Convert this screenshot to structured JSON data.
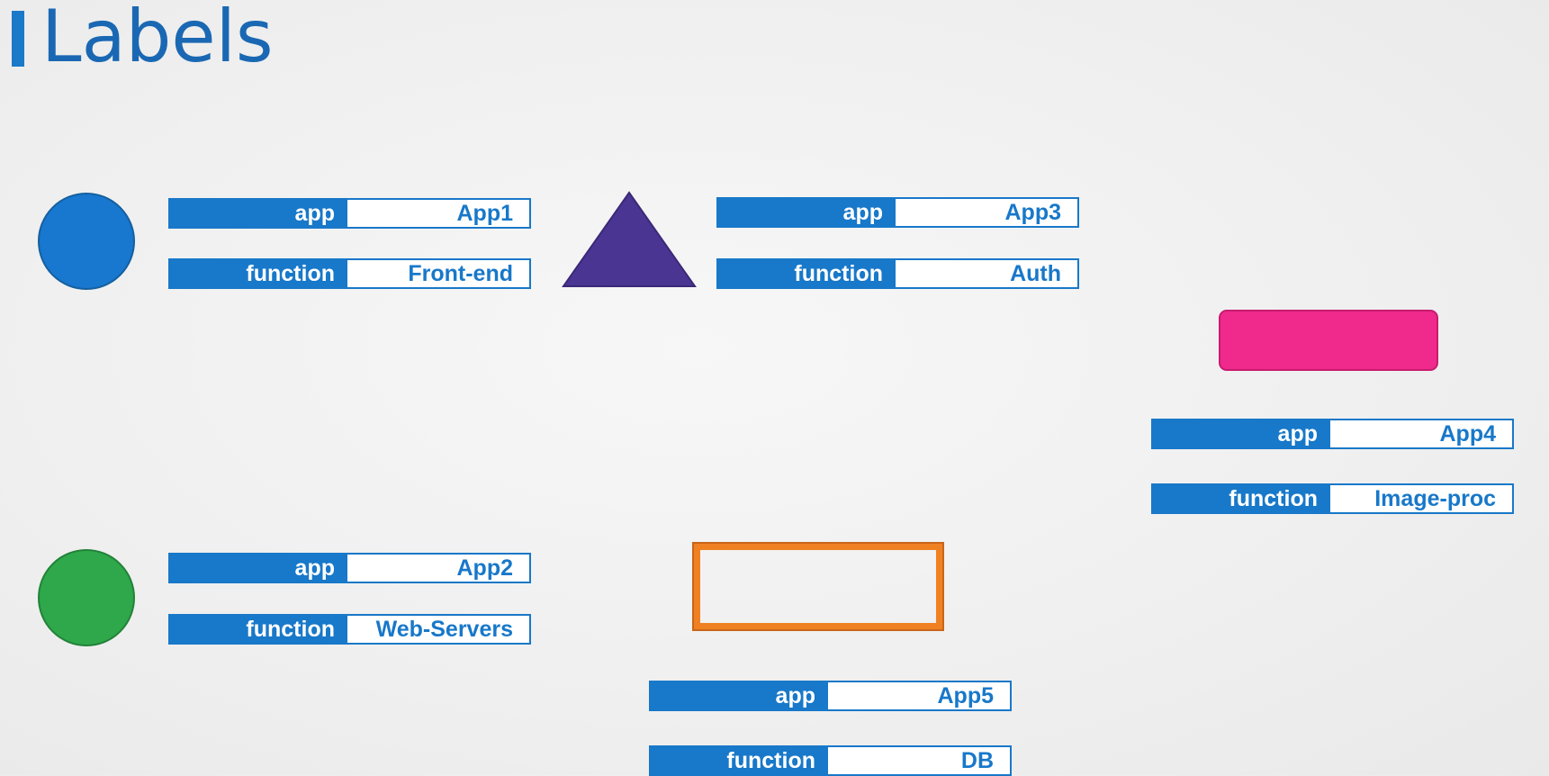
{
  "title": "Labels",
  "colors": {
    "accent": "#1878c9",
    "blue_circle": "#1877cf",
    "green_circle": "#2ea84a",
    "triangle": "#4b3592",
    "pink_rect": "#ef2a8c",
    "orange_rect": "#f08122"
  },
  "shapes": [
    {
      "shape": "circle",
      "color": "blue",
      "labels": {
        "app_key": "app",
        "app_value": "App1",
        "function_key": "function",
        "function_value": "Front-end"
      }
    },
    {
      "shape": "circle",
      "color": "green",
      "labels": {
        "app_key": "app",
        "app_value": "App2",
        "function_key": "function",
        "function_value": "Web-Servers"
      }
    },
    {
      "shape": "triangle",
      "color": "purple",
      "labels": {
        "app_key": "app",
        "app_value": "App3",
        "function_key": "function",
        "function_value": "Auth"
      }
    },
    {
      "shape": "rounded-rectangle",
      "color": "pink",
      "labels": {
        "app_key": "app",
        "app_value": "App4",
        "function_key": "function",
        "function_value": "Image-proc"
      }
    },
    {
      "shape": "rectangle-outline",
      "color": "orange",
      "labels": {
        "app_key": "app",
        "app_value": "App5",
        "function_key": "function",
        "function_value": "DB"
      }
    }
  ]
}
